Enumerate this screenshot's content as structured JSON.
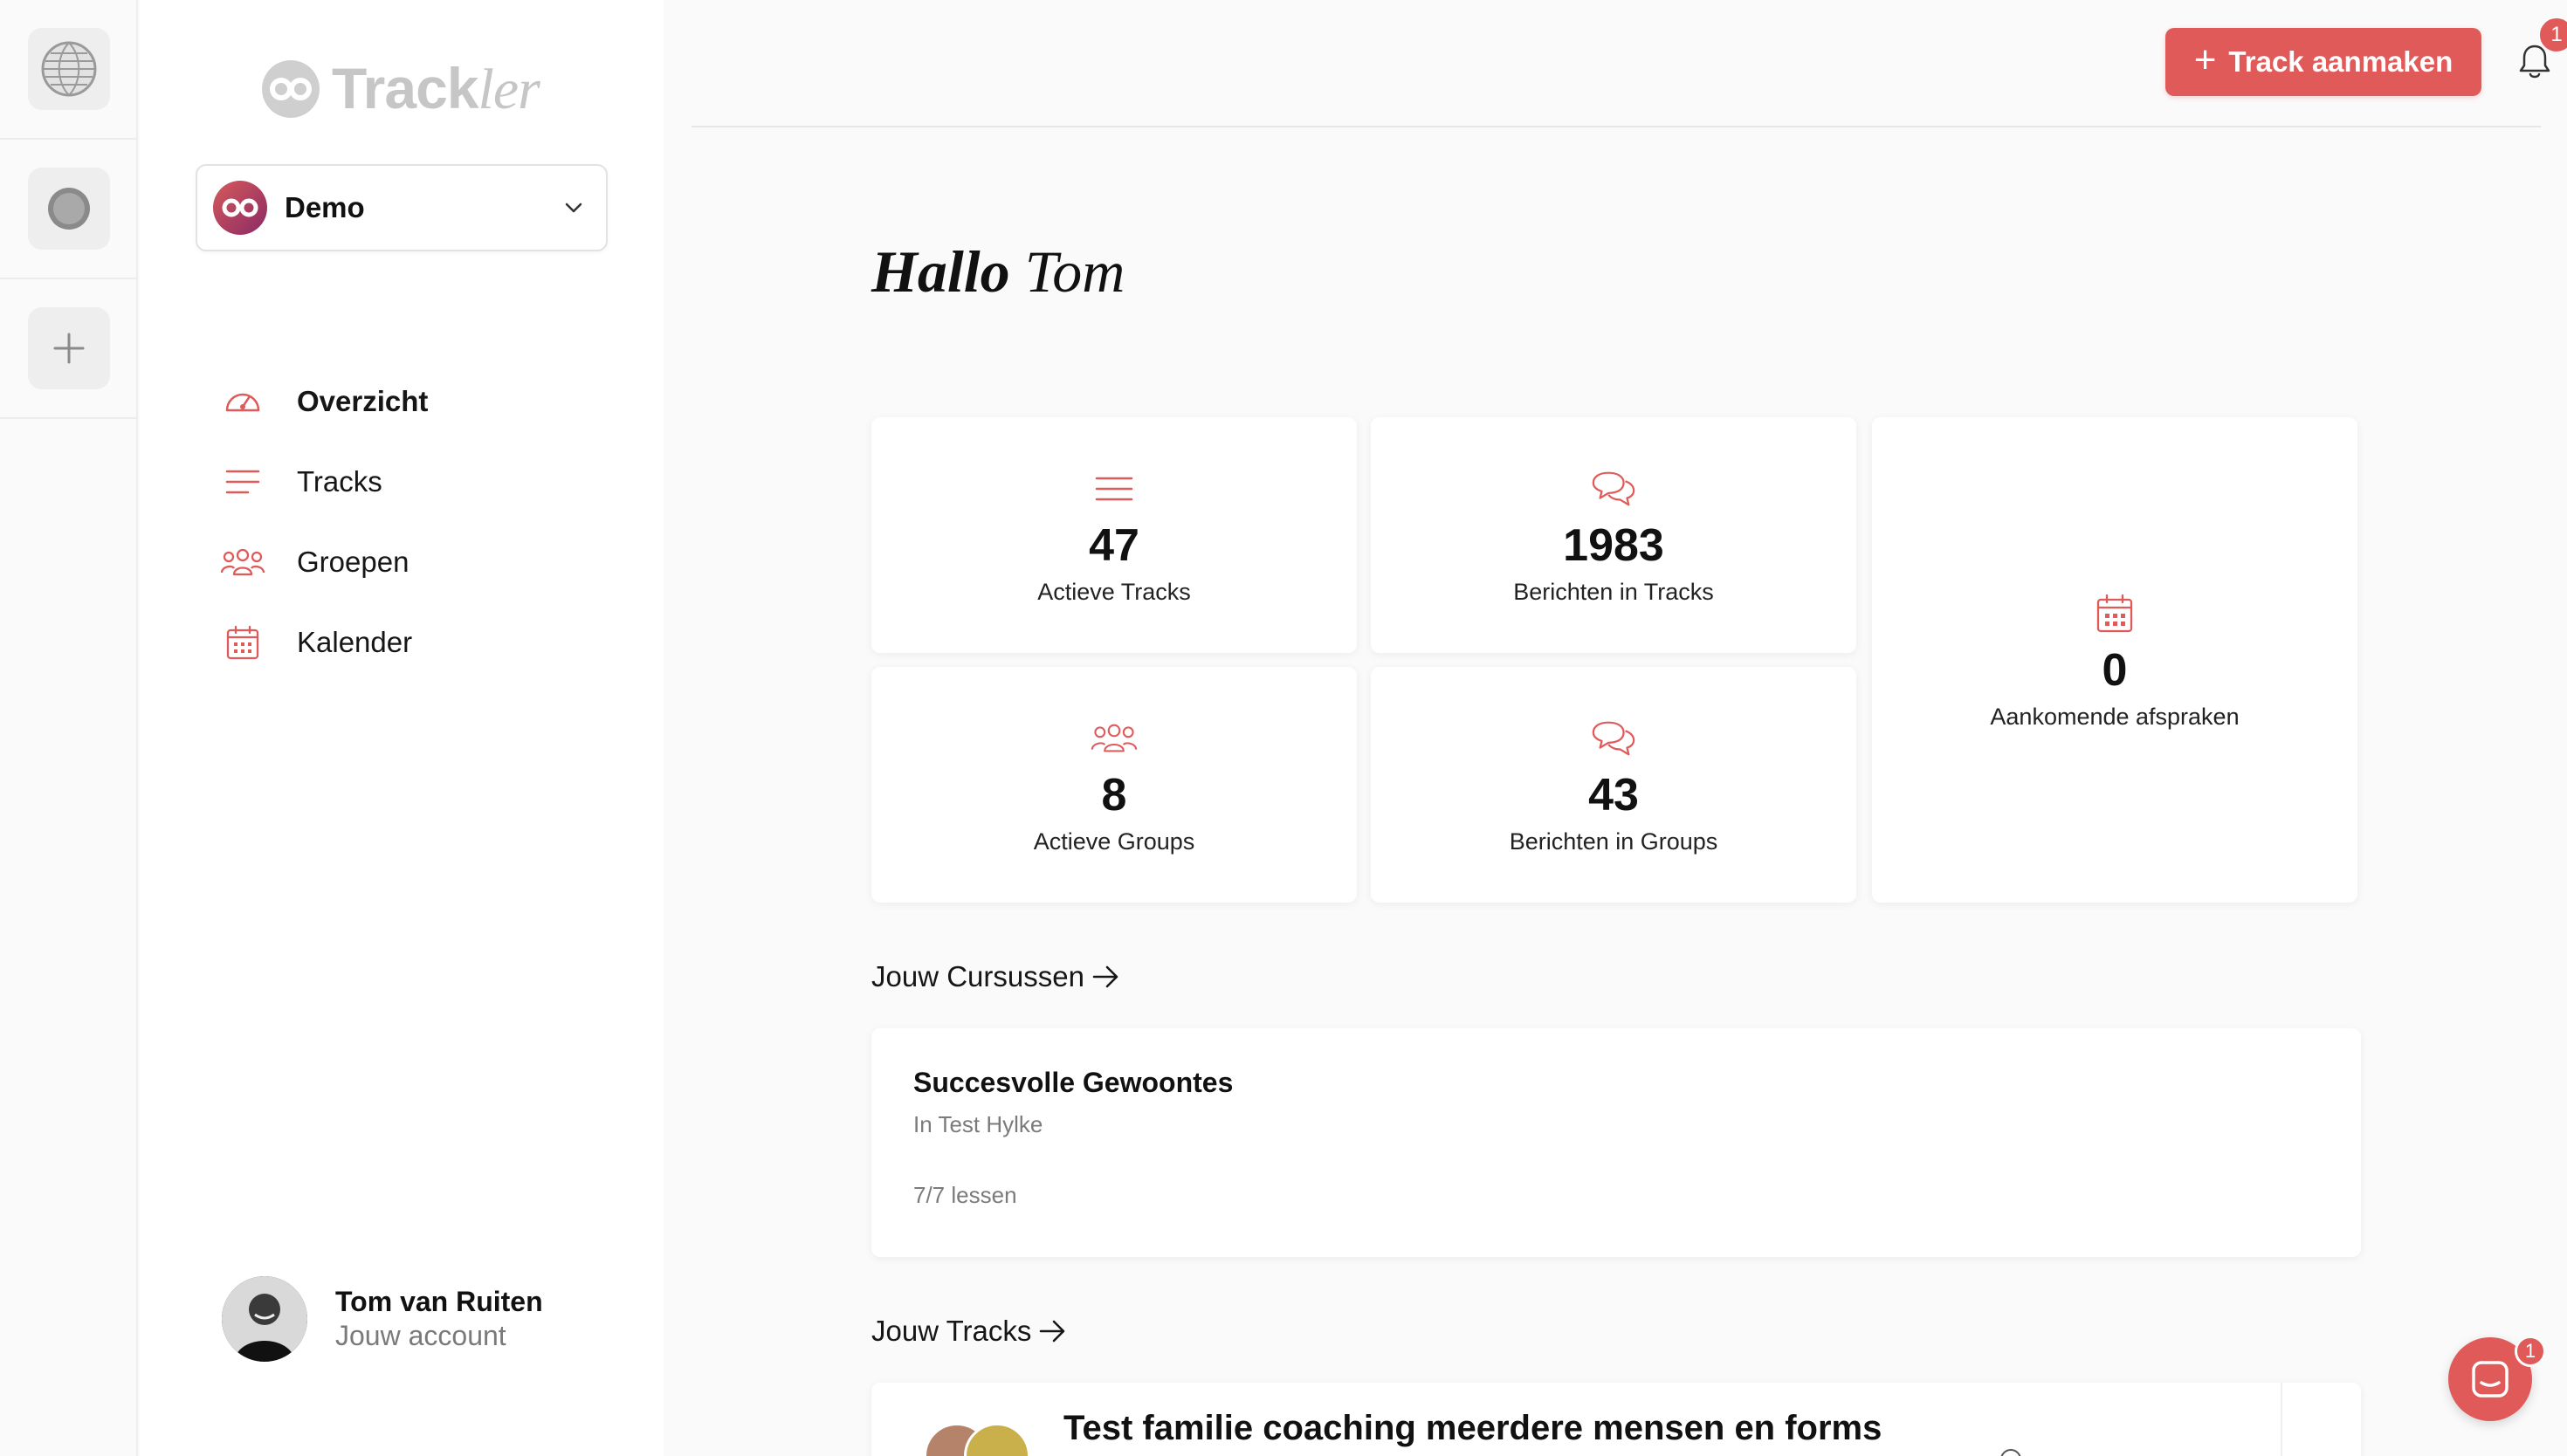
{
  "app": {
    "logo_text_main": "Track",
    "logo_text_italic": "ler"
  },
  "workspace": {
    "name": "Demo"
  },
  "nav": {
    "items": [
      {
        "label": "Overzicht",
        "icon": "gauge-icon",
        "active": true
      },
      {
        "label": "Tracks",
        "icon": "list-icon",
        "active": false
      },
      {
        "label": "Groepen",
        "icon": "users-icon",
        "active": false
      },
      {
        "label": "Kalender",
        "icon": "calendar-icon",
        "active": false
      }
    ]
  },
  "account": {
    "name": "Tom van Ruiten",
    "subtitle": "Jouw account"
  },
  "header": {
    "cta_label": "Track aanmaken",
    "notifications_count": "1"
  },
  "greeting": {
    "hello": "Hallo",
    "name": "Tom"
  },
  "stats": {
    "active_tracks": {
      "value": "47",
      "label": "Actieve Tracks"
    },
    "messages_tracks": {
      "value": "1983",
      "label": "Berichten in Tracks"
    },
    "upcoming": {
      "value": "0",
      "label": "Aankomende afspraken"
    },
    "active_groups": {
      "value": "8",
      "label": "Actieve Groups"
    },
    "messages_groups": {
      "value": "43",
      "label": "Berichten in Groups"
    }
  },
  "courses": {
    "section_title": "Jouw Cursussen",
    "items": [
      {
        "title": "Succesvolle Gewoontes",
        "subtitle": "In Test Hylke",
        "progress": "7/7 lessen"
      }
    ]
  },
  "tracks": {
    "section_title": "Jouw Tracks",
    "items": [
      {
        "title": "Test familie coaching meerdere mensen en forms"
      }
    ]
  },
  "chat": {
    "badge_count": "1"
  },
  "colors": {
    "accent": "#e05a5a",
    "background": "#fafafa",
    "card": "#ffffff"
  }
}
